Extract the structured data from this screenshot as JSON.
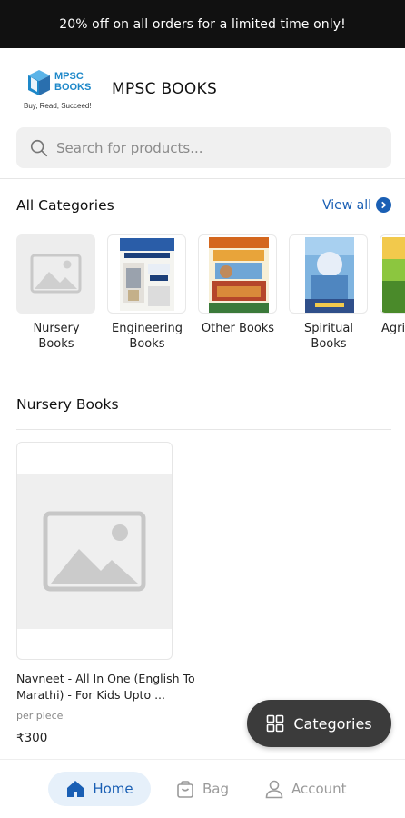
{
  "banner": {
    "text": "20% off on all orders for a limited time only!"
  },
  "header": {
    "logo_line1": "MPSC",
    "logo_line2": "BOOKS",
    "logo_tagline": "Buy, Read, Succeed!",
    "brand_name": "MPSC BOOKS"
  },
  "search": {
    "placeholder": "Search for products..."
  },
  "categories": {
    "title": "All Categories",
    "view_all": "View all",
    "items": [
      {
        "label": "Nursery Books"
      },
      {
        "label": "Engineering Books"
      },
      {
        "label": "Other Books"
      },
      {
        "label": "Spiritual Books"
      },
      {
        "label": "Agri B"
      }
    ]
  },
  "nursery": {
    "title": "Nursery Books",
    "products": [
      {
        "name": "Navneet - All In One (English To Marathi) - For Kids Upto ...",
        "unit": "per piece",
        "price": "₹300"
      }
    ]
  },
  "fab": {
    "label": "Categories"
  },
  "bottom_nav": {
    "home": "Home",
    "bag": "Bag",
    "account": "Account"
  },
  "colors": {
    "accent": "#1a5fb4",
    "banner_bg": "#111111",
    "fab_bg": "#3b3b3b",
    "home_pill": "#e6f0fa"
  }
}
